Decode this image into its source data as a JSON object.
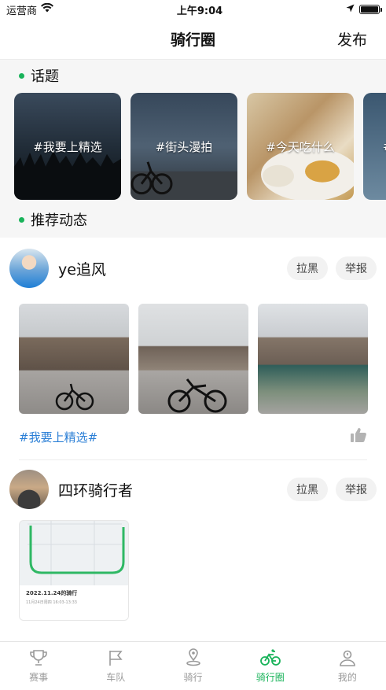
{
  "status_bar": {
    "carrier": "运营商",
    "time": "上午9:04"
  },
  "nav": {
    "title": "骑行圈",
    "publish": "发布"
  },
  "sections": {
    "topics": "话题",
    "recommended": "推荐动态"
  },
  "topics": [
    {
      "label": "#我要上精选"
    },
    {
      "label": "#街头漫拍"
    },
    {
      "label": "#今天吃什么"
    },
    {
      "label": "#"
    }
  ],
  "posts": [
    {
      "username": "ye追风",
      "block": "拉黑",
      "report": "举报",
      "tag": "#我要上精选#"
    },
    {
      "username": "四环骑行者",
      "block": "拉黑",
      "report": "举报",
      "map_title": "2022.11.24的骑行",
      "map_sub": "11月24日周四 16:03-13:33"
    }
  ],
  "tabs": [
    {
      "label": "赛事",
      "icon": "trophy-icon",
      "active": false
    },
    {
      "label": "车队",
      "icon": "flag-icon",
      "active": false
    },
    {
      "label": "骑行",
      "icon": "location-icon",
      "active": false
    },
    {
      "label": "骑行圈",
      "icon": "bicycle-icon",
      "active": true
    },
    {
      "label": "我的",
      "icon": "user-icon",
      "active": false
    }
  ],
  "colors": {
    "accent": "#19b35a",
    "tag": "#2b7fd6"
  }
}
